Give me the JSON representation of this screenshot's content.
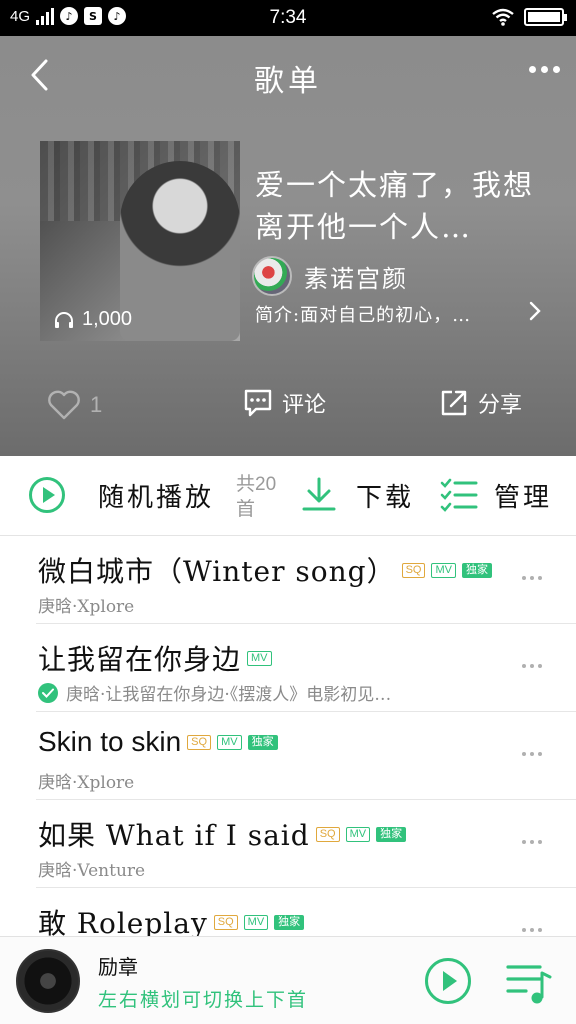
{
  "status_bar": {
    "network": "4G",
    "time": "7:34"
  },
  "header": {
    "title": "歌单"
  },
  "playlist": {
    "title": "爱一个太痛了，我想离开他一个人…",
    "play_count": "1,000",
    "creator": "素诺宫颜",
    "intro": "简介:面对自己的初心，…",
    "like_count": "1",
    "comment_label": "评论",
    "share_label": "分享"
  },
  "controls": {
    "shuffle_label": "随机播放",
    "count_label": "共20首",
    "download_label": "下载",
    "manage_label": "管理"
  },
  "tags": {
    "sq": "SQ",
    "mv": "MV",
    "exclusive": "独家"
  },
  "songs": [
    {
      "title": "微白城市（Winter song）",
      "subtitle": "庚晗·Xplore"
    },
    {
      "title": "让我留在你身边",
      "subtitle": "庚晗·让我留在你身边·《摆渡人》电影初见…"
    },
    {
      "title": "Skin to skin",
      "subtitle": "庚晗·Xplore"
    },
    {
      "title": "如果 What if I said",
      "subtitle": "庚晗·Venture"
    },
    {
      "title": "敢 Roleplay",
      "subtitle": ""
    }
  ],
  "player": {
    "now_playing": "励章",
    "hint": "左右横划可切换上下首"
  },
  "colors": {
    "accent": "#31c27c",
    "sq_tag": "#e0a83d"
  }
}
